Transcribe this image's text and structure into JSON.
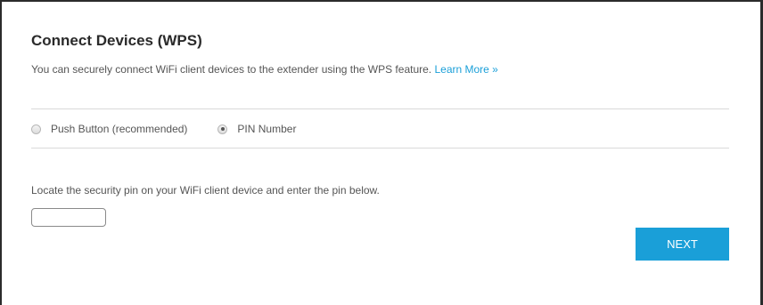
{
  "page": {
    "title": "Connect Devices (WPS)",
    "description": "You can securely connect WiFi client devices to the extender using the WPS feature. ",
    "learn_more": "Learn More »"
  },
  "wps_method": {
    "options": [
      {
        "label": "Push Button (recommended)",
        "selected": false
      },
      {
        "label": "PIN Number",
        "selected": true
      }
    ]
  },
  "pin": {
    "instruction": "Locate the security pin on your WiFi client device and enter the pin below.",
    "value": "",
    "placeholder": ""
  },
  "actions": {
    "next_label": "NEXT"
  },
  "colors": {
    "accent": "#1a9fd8",
    "text": "#555555",
    "heading": "#2a2a2a",
    "divider": "#d9d9d9"
  }
}
